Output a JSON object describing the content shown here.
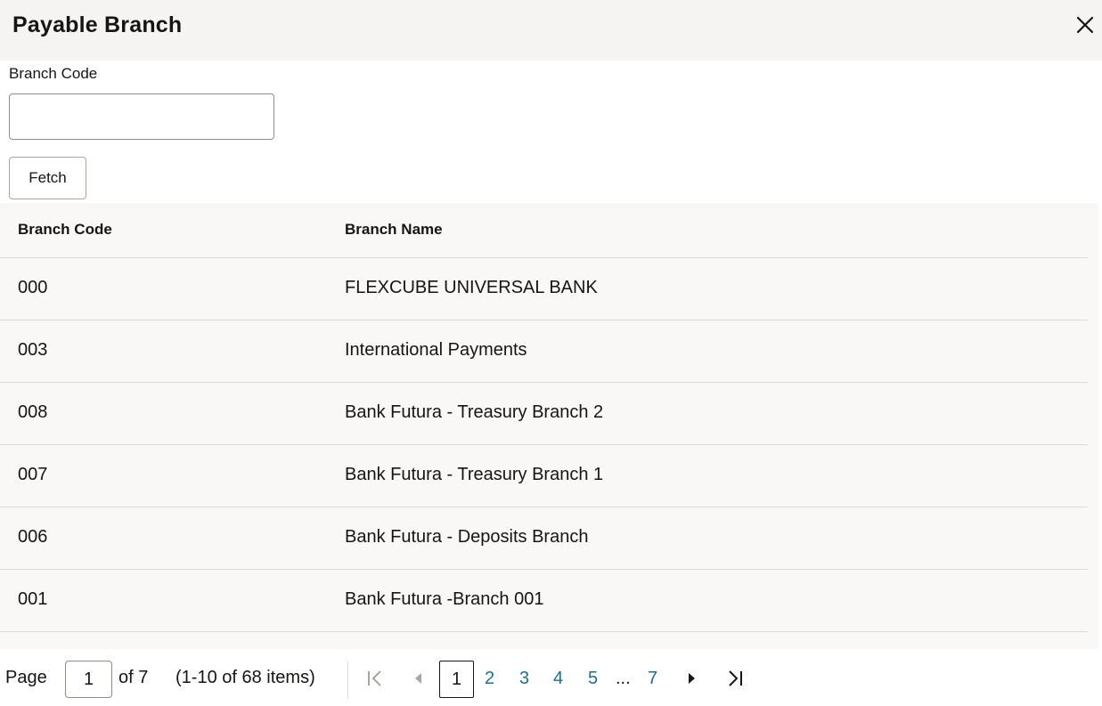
{
  "dialog": {
    "title": "Payable Branch"
  },
  "form": {
    "branch_code_label": "Branch Code",
    "branch_code_value": "",
    "fetch_label": "Fetch"
  },
  "table": {
    "columns": [
      "Branch Code",
      "Branch Name"
    ],
    "rows": [
      {
        "code": "000",
        "name": "FLEXCUBE UNIVERSAL BANK"
      },
      {
        "code": "003",
        "name": "International Payments"
      },
      {
        "code": "008",
        "name": "Bank Futura - Treasury Branch 2"
      },
      {
        "code": "007",
        "name": "Bank Futura - Treasury Branch 1"
      },
      {
        "code": "006",
        "name": "Bank Futura - Deposits Branch"
      },
      {
        "code": "001",
        "name": "Bank Futura -Branch 001"
      }
    ]
  },
  "pagination": {
    "page_label": "Page",
    "current_page": "1",
    "of_label": "of 7",
    "items_summary": "(1-10 of 68 items)",
    "pages": [
      "1",
      "2",
      "3",
      "4",
      "5",
      "7"
    ],
    "ellipsis": "..."
  },
  "colors": {
    "header_bg": "#f5f4f2",
    "grid_bg": "#f9f8f6",
    "link": "#1d6f8c",
    "text": "#161513"
  },
  "icons": {
    "close": "close-icon",
    "first_page": "first-page-icon",
    "previous_page": "previous-page-icon",
    "next_page": "next-page-icon",
    "last_page": "last-page-icon"
  }
}
